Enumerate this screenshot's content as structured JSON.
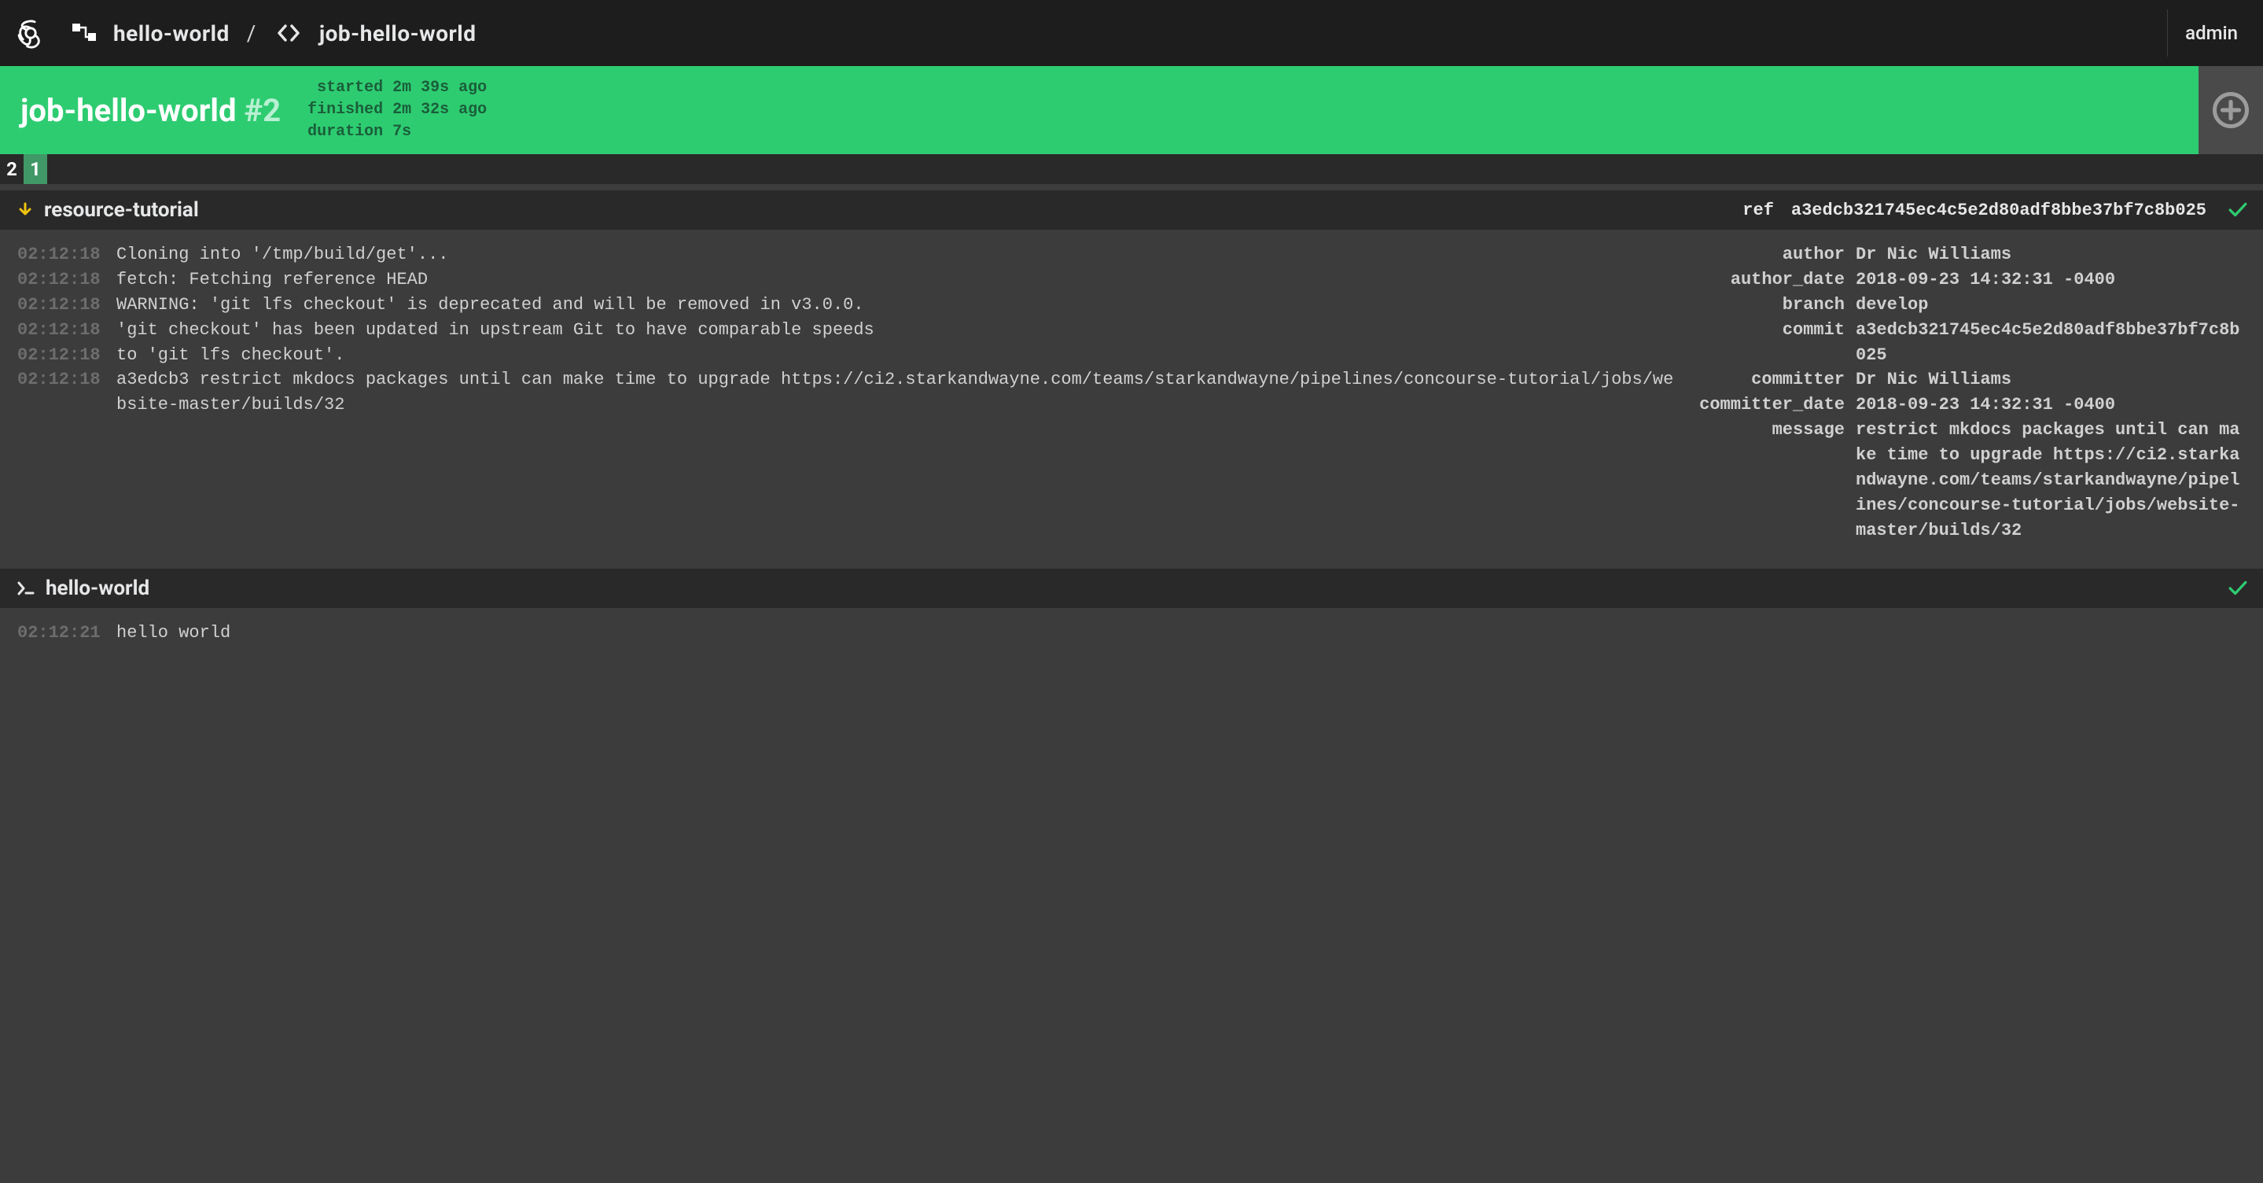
{
  "topbar": {
    "pipeline": "hello-world",
    "separator": "/",
    "job": "job-hello-world",
    "user": "admin"
  },
  "build": {
    "job_name": "job-hello-world",
    "number": "#2",
    "meta": [
      {
        "k": "started",
        "v": "2m 39s ago"
      },
      {
        "k": "finished",
        "v": "2m 32s ago"
      },
      {
        "k": "duration",
        "v": "7s"
      }
    ],
    "tabs": [
      {
        "label": "2",
        "active": false
      },
      {
        "label": "1",
        "active": true
      }
    ]
  },
  "steps": [
    {
      "type": "get",
      "name": "resource-tutorial",
      "ref_label": "ref",
      "ref_value": "a3edcb321745ec4c5e2d80adf8bbe37bf7c8b025",
      "success": true,
      "log": [
        {
          "ts": "02:12:18",
          "msg": "Cloning into '/tmp/build/get'..."
        },
        {
          "ts": "02:12:18",
          "msg": "fetch: Fetching reference HEAD"
        },
        {
          "ts": "02:12:18",
          "msg": "WARNING: 'git lfs checkout' is deprecated and will be removed in v3.0.0."
        },
        {
          "ts": "02:12:18",
          "msg": "'git checkout' has been updated in upstream Git to have comparable speeds"
        },
        {
          "ts": "02:12:18",
          "msg": "to 'git lfs checkout'."
        },
        {
          "ts": "02:12:18",
          "msg": "a3edcb3 restrict mkdocs packages until can make time to upgrade https://ci2.starkandwayne.com/teams/starkandwayne/pipelines/concourse-tutorial/jobs/website-master/builds/32"
        }
      ],
      "metadata": [
        {
          "k": "author",
          "v": "Dr Nic Williams"
        },
        {
          "k": "author_date",
          "v": "2018-09-23 14:32:31 -0400"
        },
        {
          "k": "branch",
          "v": "develop"
        },
        {
          "k": "commit",
          "v": "a3edcb321745ec4c5e2d80adf8bbe37bf7c8b025"
        },
        {
          "k": "committer",
          "v": "Dr Nic Williams"
        },
        {
          "k": "committer_date",
          "v": "2018-09-23 14:32:31 -0400"
        },
        {
          "k": "message",
          "v": "restrict mkdocs packages until can make time to upgrade https://ci2.starkandwayne.com/teams/starkandwayne/pipelines/concourse-tutorial/jobs/website-master/builds/32"
        }
      ]
    },
    {
      "type": "task",
      "name": "hello-world",
      "success": true,
      "log": [
        {
          "ts": "02:12:21",
          "msg": "hello world"
        }
      ]
    }
  ]
}
